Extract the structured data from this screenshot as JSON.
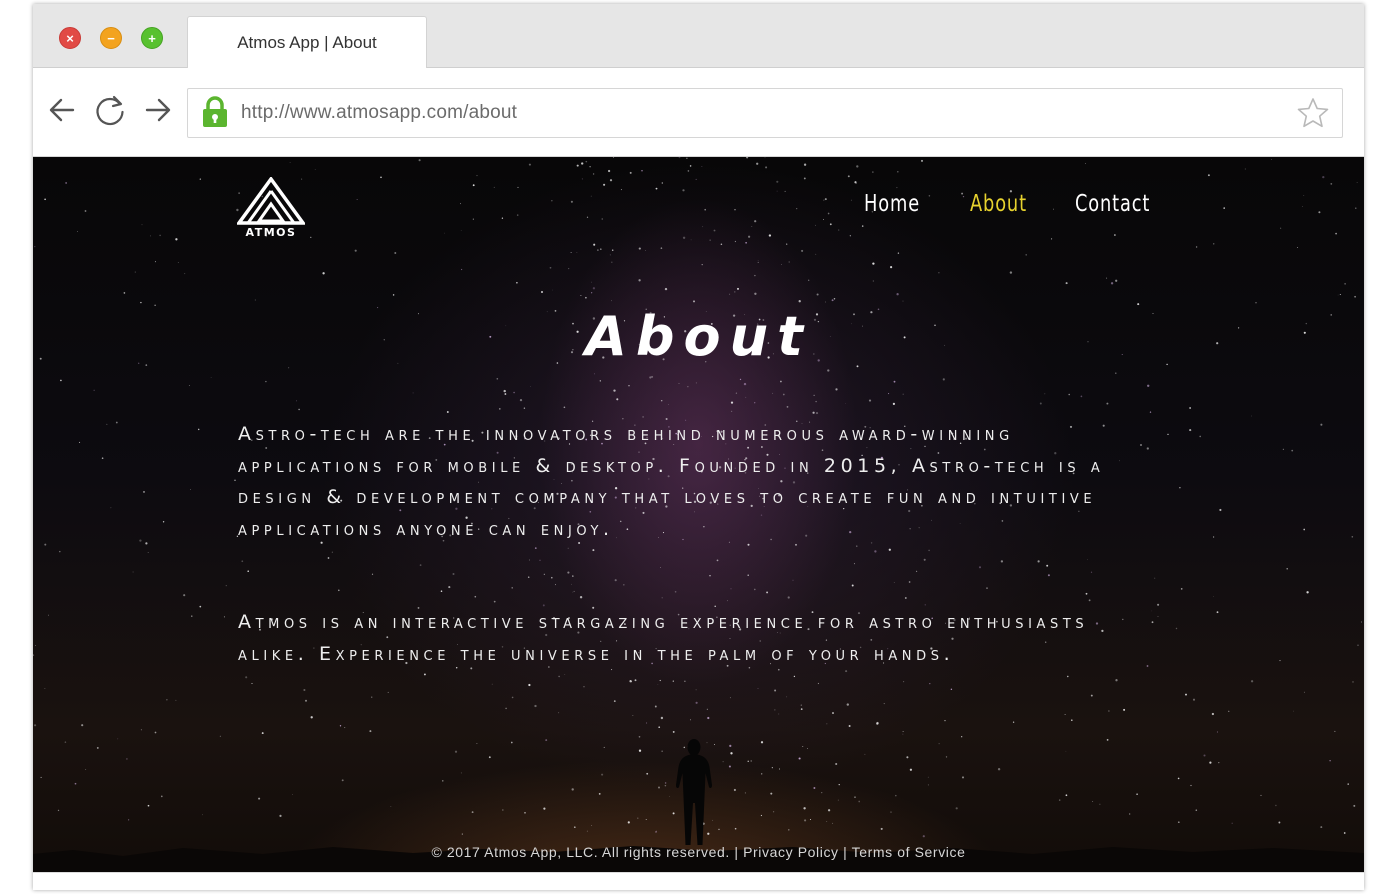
{
  "browser": {
    "tab_title": "Atmos App | About",
    "url": "http://www.atmosapp.com/about",
    "window_controls": {
      "close": "×",
      "minimize": "−",
      "maximize": "+"
    },
    "icons": [
      "back-arrow-icon",
      "reload-icon",
      "forward-arrow-icon",
      "lock-icon",
      "bookmark-star-icon"
    ],
    "colors": {
      "lock": "#5bb52f",
      "close": "#e14a45",
      "minimize": "#f3a31f",
      "maximize": "#58c12f"
    }
  },
  "site": {
    "logo_text": "ATMOS",
    "nav": [
      {
        "label": "Home",
        "active": false
      },
      {
        "label": "About",
        "active": true
      },
      {
        "label": "Contact",
        "active": false
      }
    ],
    "colors": {
      "nav_active": "#e7d22e",
      "text": "#ffffff"
    }
  },
  "main": {
    "title": "About",
    "paragraphs": [
      "Astro-tech are the innovators behind numerous award-winning applications for mobile & desktop. Founded in 2015, Astro-tech is a design & development company that loves to create fun and intuitive applications anyone can enjoy.",
      "Atmos is an interactive stargazing experience for astro enthusiasts alike. Experience the universe in the palm of your hands."
    ]
  },
  "footer": {
    "copyright": "© 2017 Atmos App, LLC. All rights reserved.",
    "separator": "|",
    "privacy": "Privacy Policy",
    "terms": "Terms of Service"
  }
}
